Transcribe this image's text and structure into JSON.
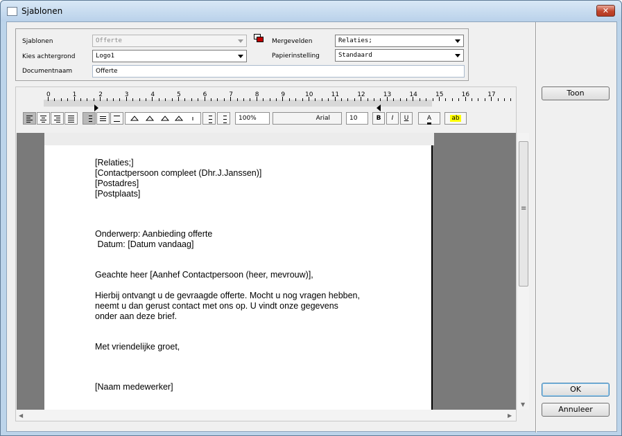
{
  "window": {
    "title": "Sjablonen",
    "close_glyph": "✕"
  },
  "form": {
    "sjablonen_label": "Sjablonen",
    "sjablonen_value": "Offerte",
    "achtergrond_label": "Kies achtergrond",
    "achtergrond_value": "Logo1",
    "documentnaam_label": "Documentnaam",
    "documentnaam_value": "Offerte",
    "mergevelden_label": "Mergevelden",
    "mergevelden_value": "Relaties;",
    "papier_label": "Papierinstelling",
    "papier_value": "Standaard",
    "merge_icon": "merge-fields-icon"
  },
  "ruler": {
    "numbers": [
      "0",
      "1",
      "2",
      "3",
      "4",
      "5",
      "6",
      "7",
      "8",
      "9",
      "10",
      "11",
      "12",
      "13",
      "14",
      "15",
      "16",
      "17"
    ]
  },
  "toolbar": {
    "zoom": "100%",
    "font_name": "Arial",
    "font_size": "10",
    "bold": "B",
    "italic": "I",
    "underline": "U",
    "font_color_label": "A",
    "highlight_label": "ab"
  },
  "document": {
    "lines": [
      "[Relaties;]",
      "[Contactpersoon compleet (Dhr.J.Janssen)]",
      "[Postadres]",
      "[Postplaats]",
      "Onderwerp: Aanbieding offerte",
      " Datum: [Datum vandaag]",
      "Geachte heer [Aanhef Contactpersoon (heer, mevrouw)],",
      "Hierbij ontvangt u de gevraagde offerte. Mocht u nog vragen hebben,",
      "neemt u dan gerust contact met ons op. U vindt onze gegevens",
      "onder aan deze brief.",
      "Met vriendelijke groet,",
      "[Naam medewerker]"
    ]
  },
  "buttons": {
    "toon": "Toon",
    "ok": "OK",
    "annuleer": "Annuleer"
  }
}
